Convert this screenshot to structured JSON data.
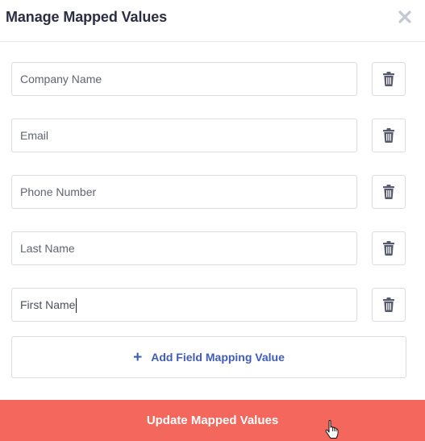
{
  "modal": {
    "title": "Manage Mapped Values",
    "close_icon": "close-icon"
  },
  "fields": [
    {
      "placeholder": "Company Name",
      "value": ""
    },
    {
      "placeholder": "Email",
      "value": ""
    },
    {
      "placeholder": "Phone Number",
      "value": ""
    },
    {
      "placeholder": "Last Name",
      "value": ""
    },
    {
      "placeholder": "",
      "value": "First Name",
      "focused": true
    }
  ],
  "delete_icon": "trash-icon",
  "add_mapping": {
    "icon": "plus-icon",
    "label": "Add Field Mapping Value"
  },
  "submit": {
    "label": "Update Mapped Values"
  },
  "colors": {
    "accent": "#3f5db4",
    "submit_bg": "#f4675c",
    "border": "#d9dce5",
    "title": "#2b2d42"
  }
}
